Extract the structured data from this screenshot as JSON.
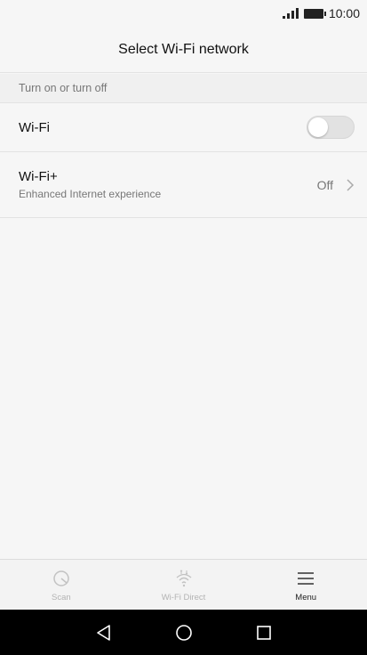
{
  "status": {
    "time": "10:00",
    "icons": [
      "signal-icon",
      "battery-icon"
    ]
  },
  "header": {
    "title": "Select Wi-Fi network"
  },
  "section": {
    "title": "Turn on or turn off"
  },
  "settings": {
    "wifi": {
      "label": "Wi-Fi",
      "enabled": false
    },
    "wifi_plus": {
      "label": "Wi-Fi+",
      "subtitle": "Enhanced Internet experience",
      "value": "Off"
    }
  },
  "bottom_bar": {
    "items": [
      {
        "label": "Scan",
        "icon": "scan-icon",
        "active": false
      },
      {
        "label": "Wi-Fi Direct",
        "icon": "wifi-direct-icon",
        "active": false
      },
      {
        "label": "Menu",
        "icon": "menu-icon",
        "active": true
      }
    ]
  },
  "nav": {
    "icons": [
      "back-icon",
      "home-icon",
      "recents-icon"
    ]
  },
  "colors": {
    "background": "#f6f6f6",
    "divider": "#e3e3e3",
    "nav_bar": "#000000"
  }
}
